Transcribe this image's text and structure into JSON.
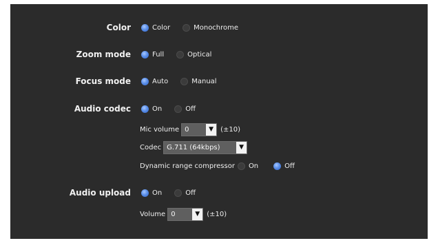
{
  "color": {
    "label": "Color",
    "options": [
      "Color",
      "Monochrome"
    ],
    "selected": 0
  },
  "zoom_mode": {
    "label": "Zoom mode",
    "options": [
      "Full",
      "Optical"
    ],
    "selected": 0
  },
  "focus_mode": {
    "label": "Focus mode",
    "options": [
      "Auto",
      "Manual"
    ],
    "selected": 0
  },
  "audio_codec": {
    "label": "Audio codec",
    "options": [
      "On",
      "Off"
    ],
    "selected": 0,
    "mic_volume": {
      "label": "Mic volume",
      "value": "0",
      "range": "(±10)"
    },
    "codec": {
      "label": "Codec",
      "value": "G.711 (64kbps)"
    },
    "drc": {
      "label": "Dynamic range compressor",
      "options": [
        "On",
        "Off"
      ],
      "selected": 1
    }
  },
  "audio_upload": {
    "label": "Audio upload",
    "options": [
      "On",
      "Off"
    ],
    "selected": 0,
    "volume": {
      "label": "Volume",
      "value": "0",
      "range": "(±10)"
    }
  },
  "icons": {
    "dropdown": "▼"
  },
  "colors": {
    "panel": "#2b2b2b",
    "radio_selected": "#4f86e0"
  }
}
